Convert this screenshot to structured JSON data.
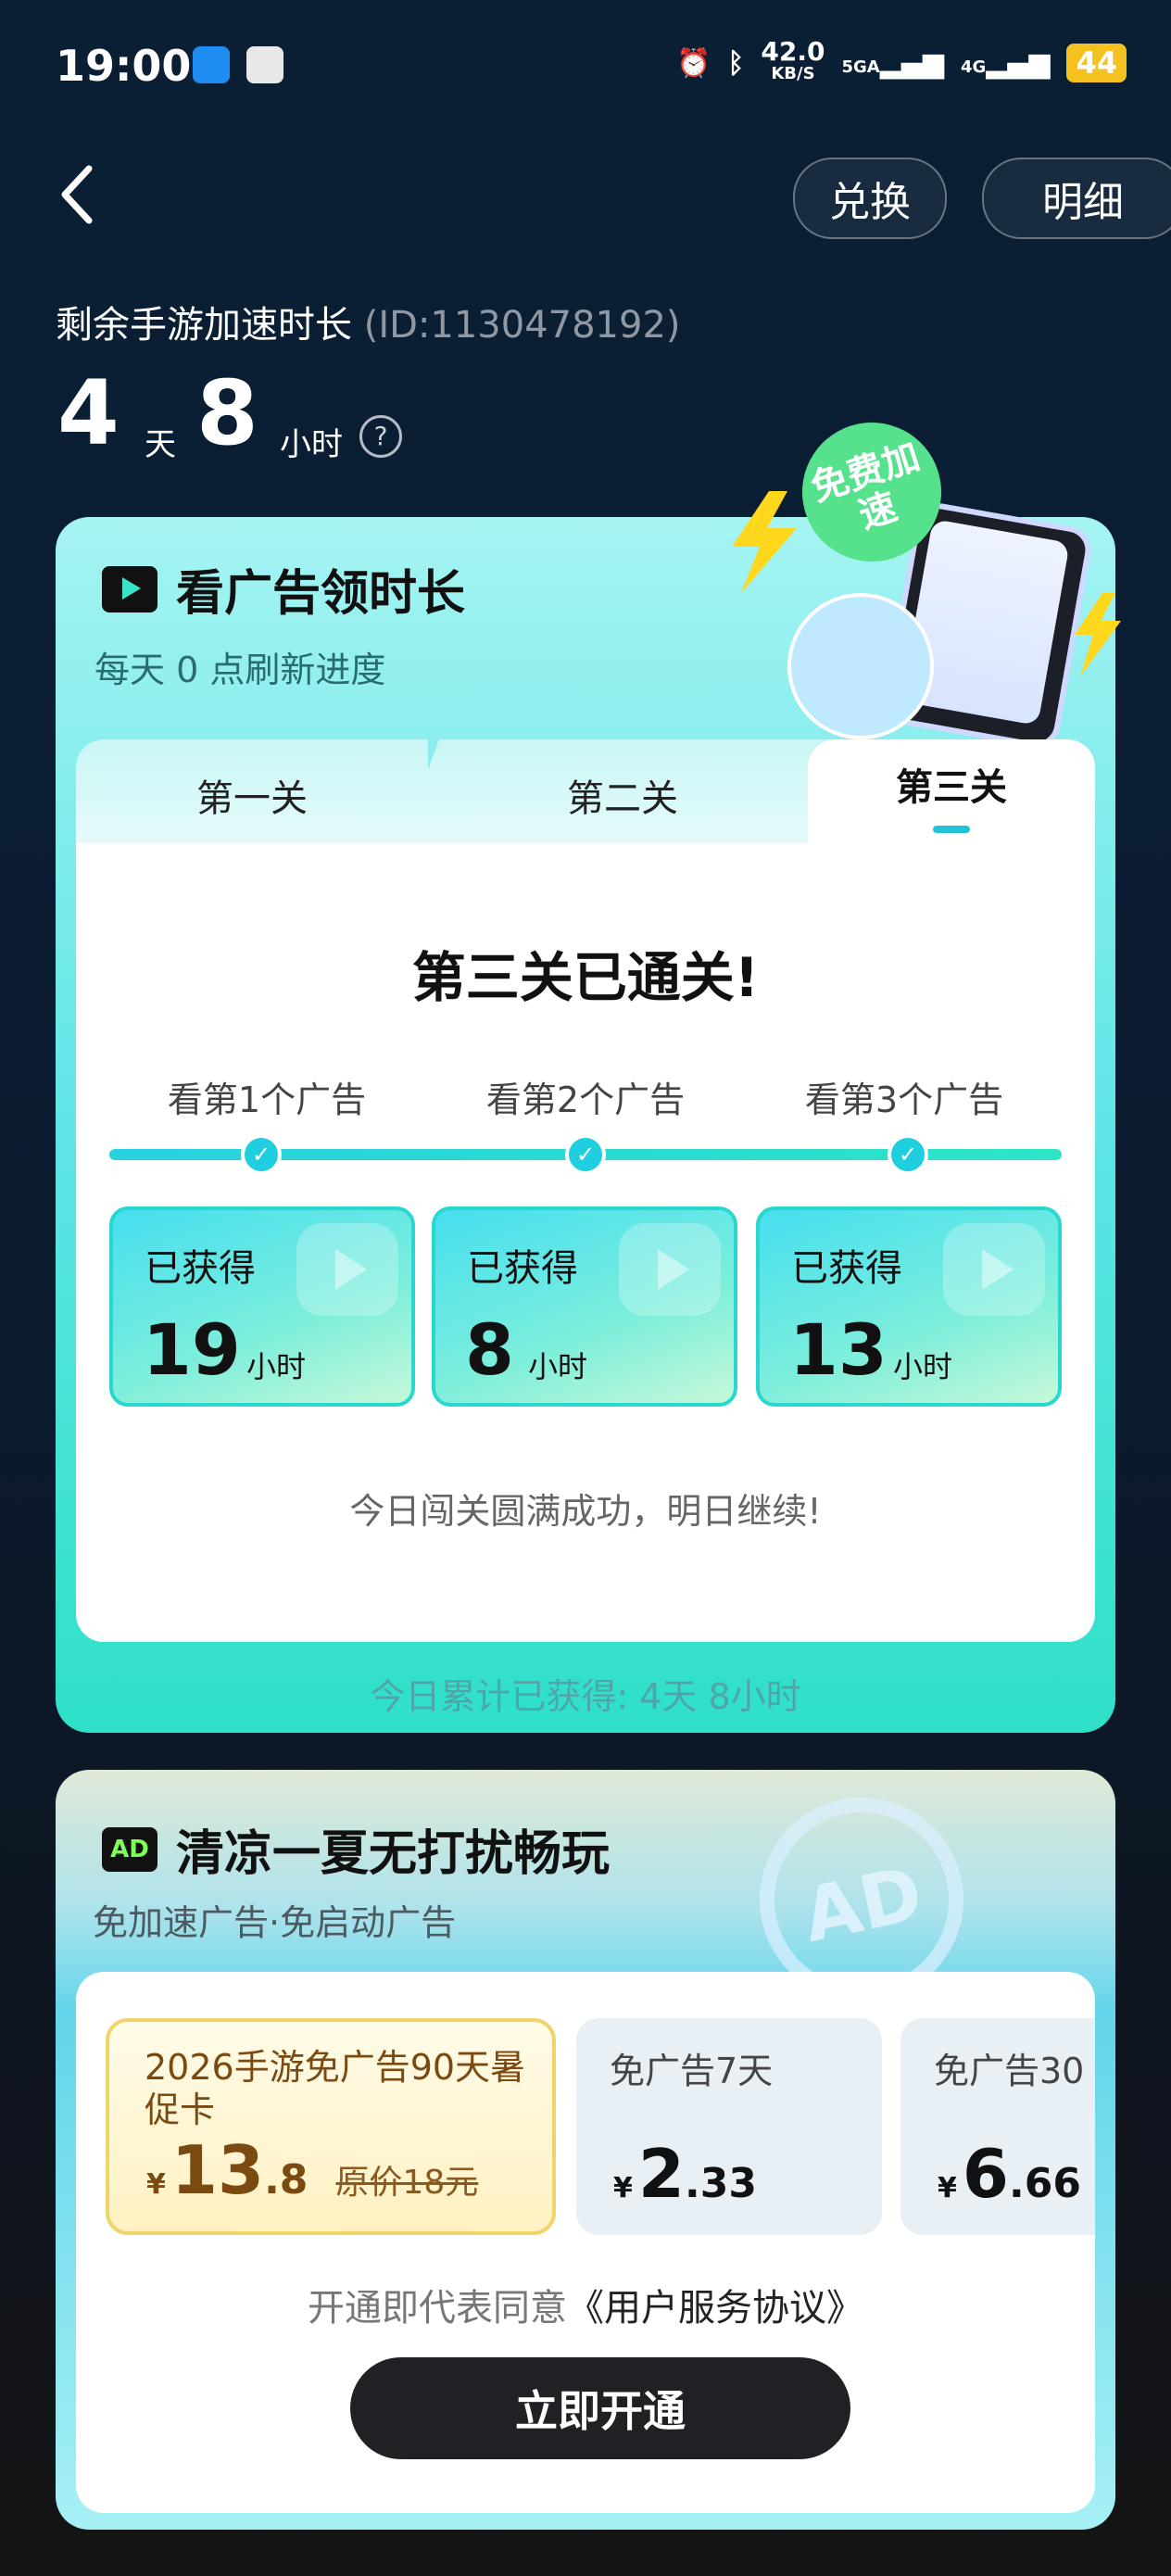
{
  "status_bar": {
    "time": "19:00",
    "speed_value": "42.0",
    "speed_unit": "KB/S",
    "network_1": "5GA",
    "network_2": "4G",
    "battery": "44"
  },
  "header": {
    "exchange_label": "兑换",
    "detail_label": "明细",
    "remain_title": "剩余手游加速时长",
    "user_id": "(ID:1130478192)",
    "days_value": "4",
    "days_unit": "天",
    "hours_value": "8",
    "hours_unit": "小时",
    "help_glyph": "?"
  },
  "ad_card": {
    "title": "看广告领时长",
    "subtitle": "每天 0 点刷新进度",
    "badge_text": "免费加速",
    "tabs": [
      {
        "label": "第一关",
        "active": false
      },
      {
        "label": "第二关",
        "active": false
      },
      {
        "label": "第三关",
        "active": true
      }
    ],
    "passed_title": "第三关已通关!",
    "steps": [
      {
        "label": "看第1个广告",
        "reward_label": "已获得",
        "reward_value": "19",
        "reward_unit": "小时"
      },
      {
        "label": "看第2个广告",
        "reward_label": "已获得",
        "reward_value": "8",
        "reward_unit": "小时"
      },
      {
        "label": "看第3个广告",
        "reward_label": "已获得",
        "reward_value": "13",
        "reward_unit": "小时"
      }
    ],
    "done_message": "今日闯关圆满成功，明日继续!",
    "today_total": "今日累计已获得: 4天 8小时"
  },
  "sub_card": {
    "icon_text": "AD",
    "title": "清凉一夏无打扰畅玩",
    "subtitle": "免加速广告·免启动广告",
    "emblem_text": "AD",
    "plans": [
      {
        "name": "2026手游免广告90天暑促卡",
        "currency": "¥",
        "price_int": "13",
        "price_dec": ".8",
        "original": "原价18元",
        "selected": true
      },
      {
        "name": "免广告7天",
        "currency": "¥",
        "price_int": "2",
        "price_dec": ".33",
        "selected": false
      },
      {
        "name": "免广告30",
        "currency": "¥",
        "price_int": "6",
        "price_dec": ".66",
        "selected": false
      }
    ],
    "agree_prefix": "开通即代表同意",
    "agreement_link": "《用户服务协议》",
    "open_button": "立即开通"
  },
  "colors": {
    "accent_cyan": "#21c3d6",
    "card_green": "#2ee0c8",
    "selected_plan_border": "#f0d36a",
    "button_dark": "#1f2125"
  }
}
